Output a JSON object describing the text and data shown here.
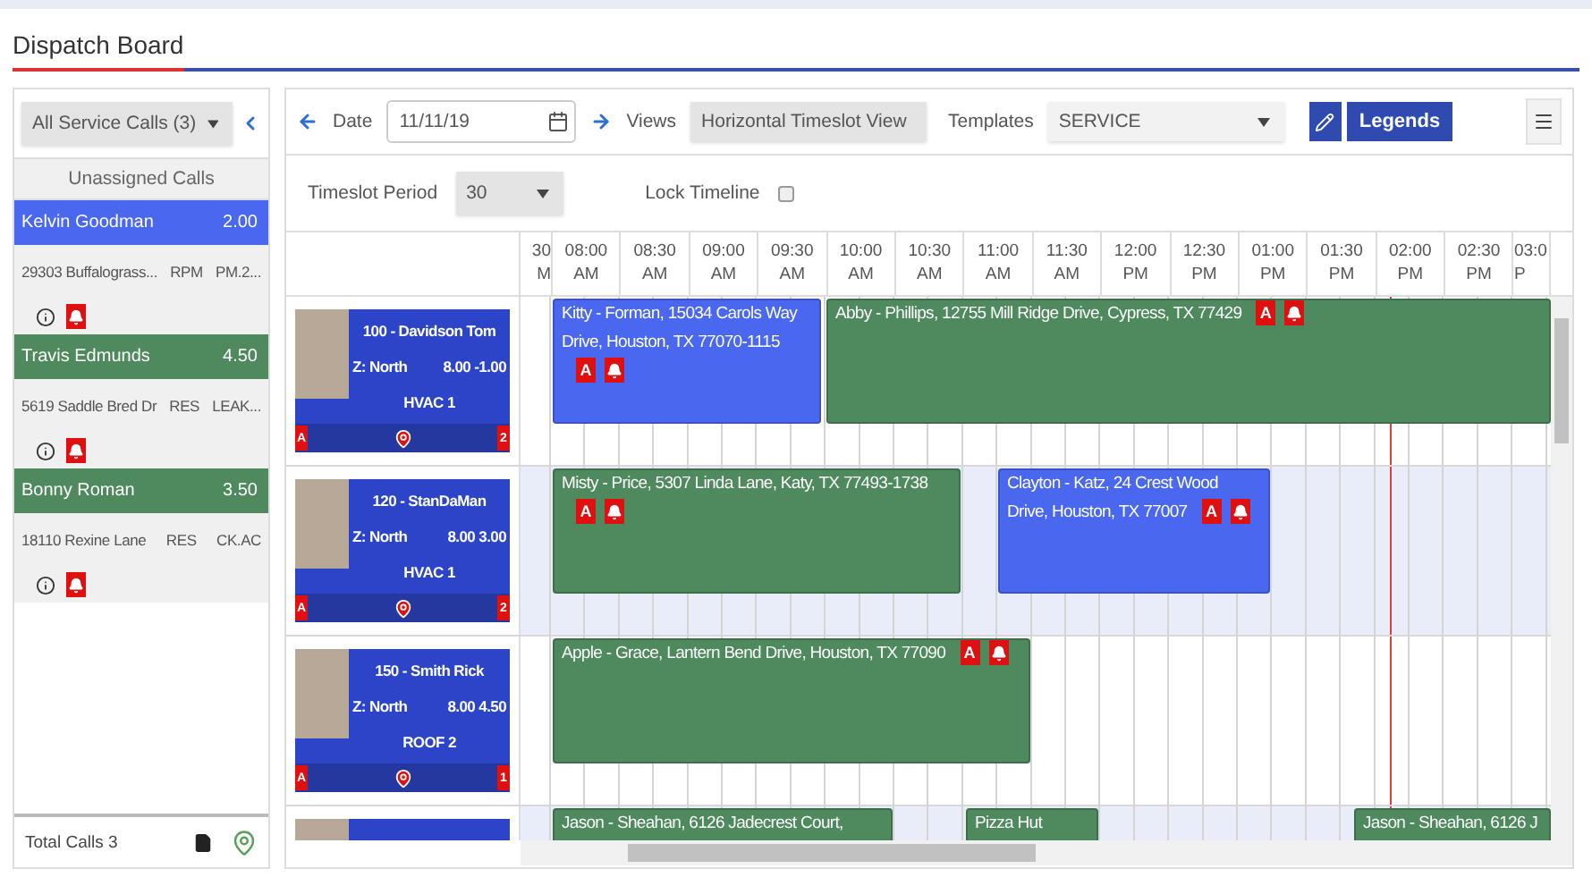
{
  "header": {
    "title": "Dispatch Board"
  },
  "sidebar": {
    "filter": "All Service Calls (3)",
    "heading": "Unassigned Calls",
    "calls": [
      {
        "name": "Kelvin Goodman",
        "hours": "2.00",
        "color": "#4a67f0",
        "address": "29303 Buffalograss...",
        "type": "RPM",
        "code": "PM.2..."
      },
      {
        "name": "Travis Edmunds",
        "hours": "4.50",
        "color": "#4e8a5e",
        "address": "5619 Saddle Bred Dr",
        "type": "RES",
        "code": "LEAK..."
      },
      {
        "name": "Bonny Roman",
        "hours": "3.50",
        "color": "#4e8a5e",
        "address": "18110 Rexine Lane",
        "type": "RES",
        "code": "CK.AC"
      }
    ],
    "total": "Total Calls 3"
  },
  "toolbar": {
    "date_label": "Date",
    "date": "11/11/19",
    "views_label": "Views",
    "view": "Horizontal Timeslot View",
    "templates_label": "Templates",
    "template": "SERVICE",
    "legends_button": "Legends"
  },
  "options": {
    "timeslot_label": "Timeslot Period",
    "timeslot": "30",
    "lock_label": "Lock Timeline",
    "lock_checked": false
  },
  "timeline": {
    "columns": [
      {
        "time": "30",
        "period": "M"
      },
      {
        "time": "08:00",
        "period": "AM"
      },
      {
        "time": "08:30",
        "period": "AM"
      },
      {
        "time": "09:00",
        "period": "AM"
      },
      {
        "time": "09:30",
        "period": "AM"
      },
      {
        "time": "10:00",
        "period": "AM"
      },
      {
        "time": "10:30",
        "period": "AM"
      },
      {
        "time": "11:00",
        "period": "AM"
      },
      {
        "time": "11:30",
        "period": "AM"
      },
      {
        "time": "12:00",
        "period": "PM"
      },
      {
        "time": "12:30",
        "period": "PM"
      },
      {
        "time": "01:00",
        "period": "PM"
      },
      {
        "time": "01:30",
        "period": "PM"
      },
      {
        "time": "02:00",
        "period": "PM"
      },
      {
        "time": "02:30",
        "period": "PM"
      },
      {
        "time": "03:0",
        "period": "P"
      }
    ],
    "rows": [
      {
        "technician": {
          "title": "100 - Davidson Tom",
          "zone": "Z: North",
          "hours": "8.00 -1.00",
          "skill": "HVAC 1",
          "mark": "A",
          "count": "2"
        },
        "events": [
          {
            "text": "Kitty - Forman, 15034 Carols Way Drive, Houston, TX 77070-1115",
            "color": "#4a67f0",
            "badge": "A"
          },
          {
            "text": "Abby - Phillips, 12755 Mill Ridge Drive, Cypress, TX 77429",
            "color": "#4e8a5e",
            "badge": "A"
          }
        ]
      },
      {
        "technician": {
          "title": "120 - StanDaMan",
          "zone": "Z: North",
          "hours": "8.00 3.00",
          "skill": "HVAC 1",
          "mark": "A",
          "count": "2"
        },
        "events": [
          {
            "text": "Misty - Price, 5307 Linda Lane, Katy, TX 77493-1738",
            "color": "#4e8a5e",
            "badge": "A"
          },
          {
            "text": "Clayton - Katz, 24 Crest Wood Drive, Houston, TX 77007",
            "color": "#4a67f0",
            "badge": "A"
          }
        ]
      },
      {
        "technician": {
          "title": "150 - Smith Rick",
          "zone": "Z: North",
          "hours": "8.00 4.50",
          "skill": "ROOF 2",
          "mark": "A",
          "count": "1"
        },
        "events": [
          {
            "text": "Apple - Grace, Lantern Bend Drive, Houston, TX 77090",
            "color": "#4e8a5e",
            "badge": "A"
          }
        ]
      },
      {
        "events": [
          {
            "text": "Jason - Sheahan, 6126 Jadecrest Court,",
            "color": "#4e8a5e"
          },
          {
            "text": "Pizza Hut",
            "color": "#4e8a5e"
          },
          {
            "text": "Jason - Sheahan, 6126 J",
            "color": "#4e8a5e"
          }
        ]
      }
    ]
  }
}
